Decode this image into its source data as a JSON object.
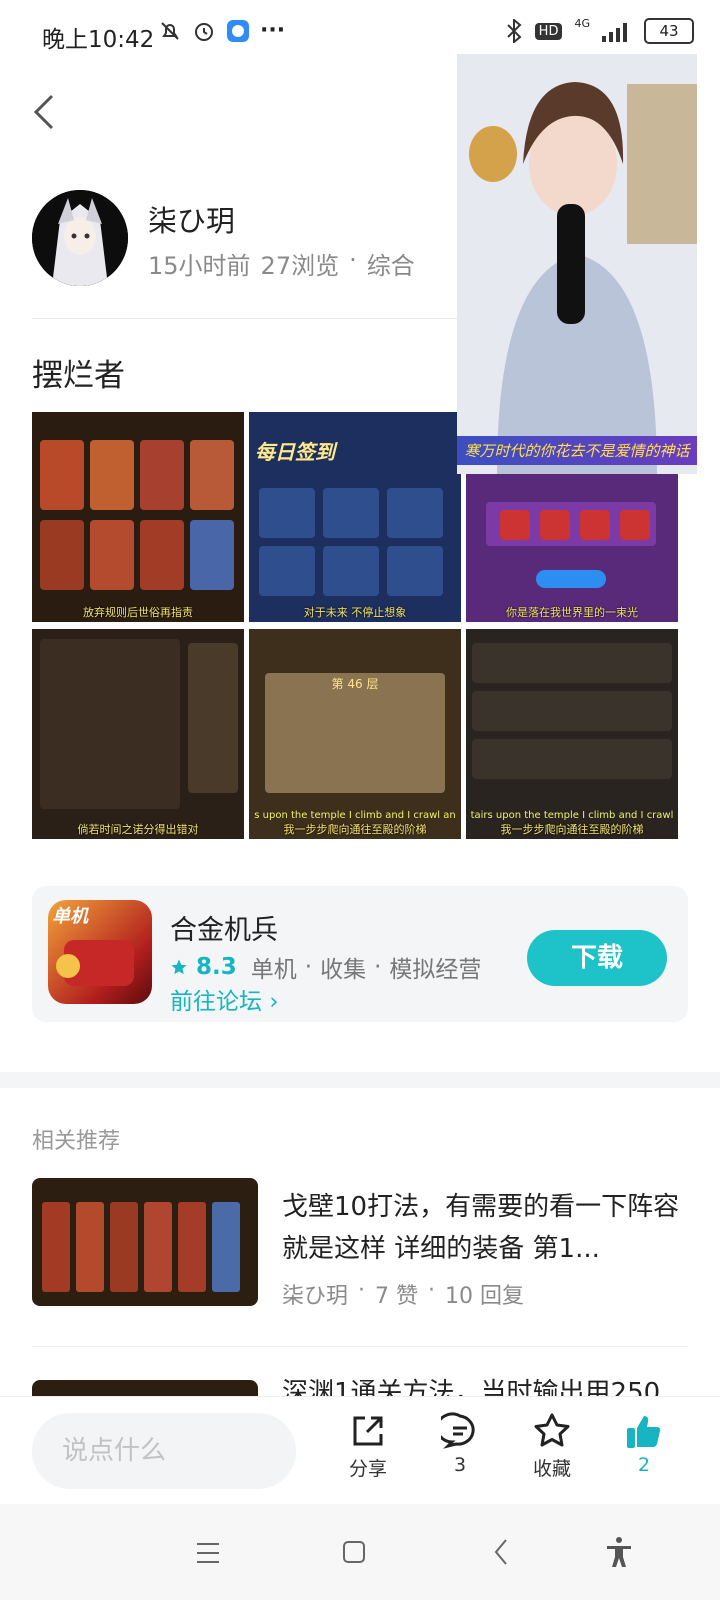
{
  "status": {
    "time": "晚上10:42",
    "battery": "43",
    "network": "4G",
    "hd": "HD",
    "more": "···"
  },
  "post": {
    "author": "柒ひ玥",
    "time_ago": "15小时前",
    "views": "27浏览",
    "dot": "·",
    "category": "综合",
    "title": "摆烂者",
    "captions": [
      "放弃规则后世俗再指责",
      "对于未来 不停止想象",
      "你是落在我世界里的一束光",
      "倘若时间之诺分得出错对",
      "我一步步爬向通往至殿的阶梯",
      "我一步步爬向通往至殿的阶梯"
    ],
    "image_texts": {
      "daily_signin": "每日签到",
      "floor": "第 46 层",
      "english_line_1": "s upon the temple I climb and I crawl an",
      "english_line_2": "tairs upon the temple I climb and I crawl"
    }
  },
  "video_overlay": {
    "caption": "寒万时代的你花去不是爱情的神话"
  },
  "app": {
    "name": "合金机兵",
    "rating": "8.3",
    "tags": [
      "单机",
      "收集",
      "模拟经营"
    ],
    "dot": "·",
    "forum_link": "前往论坛",
    "download": "下载",
    "icon_badge": "单机"
  },
  "related": {
    "section_title": "相关推荐",
    "items": [
      {
        "title": "戈壁10打法，有需要的看一下阵容就是这样 详细的装备 第1...",
        "author": "柒ひ玥",
        "likes": "7 赞",
        "replies": "10 回复"
      },
      {
        "title": "深渊1通关方法，当时输出用250"
      }
    ]
  },
  "actions": {
    "comment_placeholder": "说点什么",
    "share": "分享",
    "comments": "3",
    "favorite": "收藏",
    "likes": "2"
  },
  "colors": {
    "accent": "#1ec3c9",
    "like_active": "#17b5c2",
    "text_muted": "#8a8a8a"
  }
}
